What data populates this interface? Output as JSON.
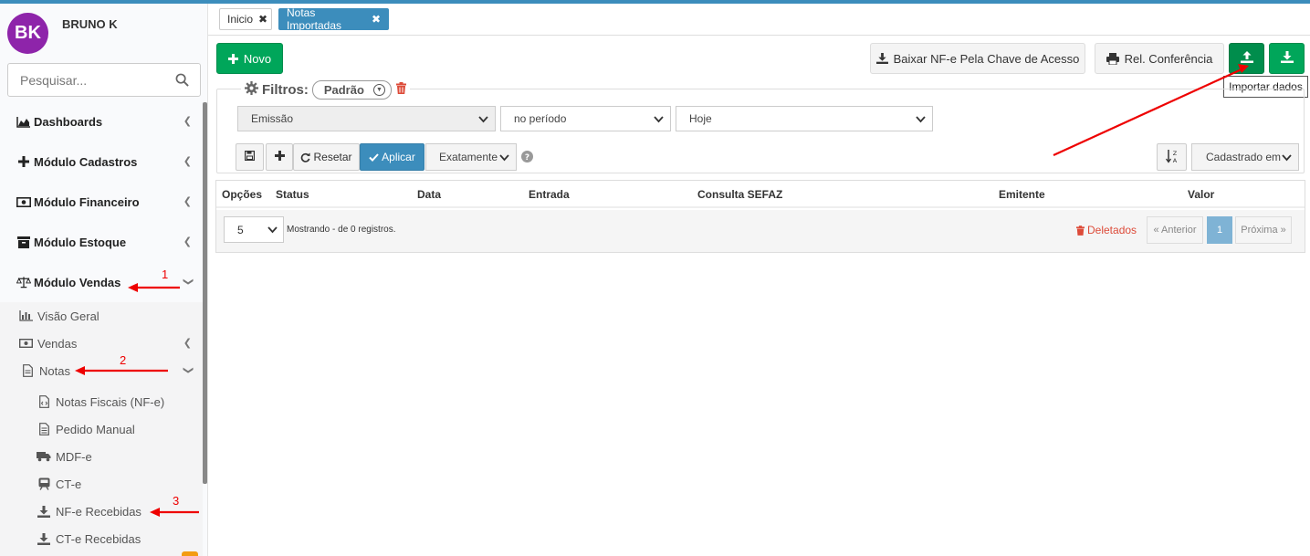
{
  "user": {
    "initials": "BK",
    "name": "BRUNO K",
    "avatar_color": "#8e24aa"
  },
  "search": {
    "placeholder": "Pesquisar..."
  },
  "menu": [
    {
      "label": "Dashboards",
      "icon": "area-chart-icon"
    },
    {
      "label": "Módulo Cadastros",
      "icon": "plus-icon"
    },
    {
      "label": "Módulo Financeiro",
      "icon": "money-icon"
    },
    {
      "label": "Módulo Estoque",
      "icon": "inventory-icon"
    },
    {
      "label": "Módulo Vendas",
      "icon": "balance-scale-icon"
    }
  ],
  "submenu": [
    {
      "label": "Visão Geral",
      "icon": "bar-chart-icon"
    },
    {
      "label": "Vendas",
      "icon": "money-icon"
    },
    {
      "label": "Notas",
      "icon": "file-icon"
    },
    {
      "label": "Notas Fiscais (NF-e)",
      "icon": "file-code-icon"
    },
    {
      "label": "Pedido Manual",
      "icon": "file-text-icon"
    },
    {
      "label": "MDF-e",
      "icon": "truck-icon"
    },
    {
      "label": "CT-e",
      "icon": "train-icon"
    },
    {
      "label": "NF-e Recebidas",
      "icon": "download-icon"
    },
    {
      "label": "CT-e Recebidas",
      "icon": "download-icon"
    }
  ],
  "tabs": [
    {
      "label": "Inicio"
    },
    {
      "label": "Notas Importadas"
    }
  ],
  "toolbar": {
    "new_label": "Novo",
    "download_key_label": "Baixar NF-e Pela Chave de Acesso",
    "report_label": "Rel. Conferência",
    "import_tooltip": "Importar dados"
  },
  "filters": {
    "title": "Filtros:",
    "preset": "Padrão",
    "field": "Emissão",
    "operator": "no período",
    "value": "Hoje",
    "reset_label": "Resetar",
    "apply_label": "Aplicar",
    "match_mode": "Exatamente",
    "sort_by": "Cadastrado em"
  },
  "table": {
    "columns": [
      "Opções",
      "Status",
      "Data",
      "Entrada",
      "Consulta SEFAZ",
      "Emitente",
      "Valor"
    ],
    "page_size": "5",
    "showing": "Mostrando - de 0 registros.",
    "deleted_label": "Deletados",
    "prev_label": "« Anterior",
    "current_page": "1",
    "next_label": "Próxima »"
  },
  "annotations": [
    "1",
    "2",
    "3"
  ],
  "colors": {
    "primary": "#3c8dbc",
    "success": "#00a65a",
    "danger": "#dd4b39",
    "annotation": "#ee0000"
  }
}
